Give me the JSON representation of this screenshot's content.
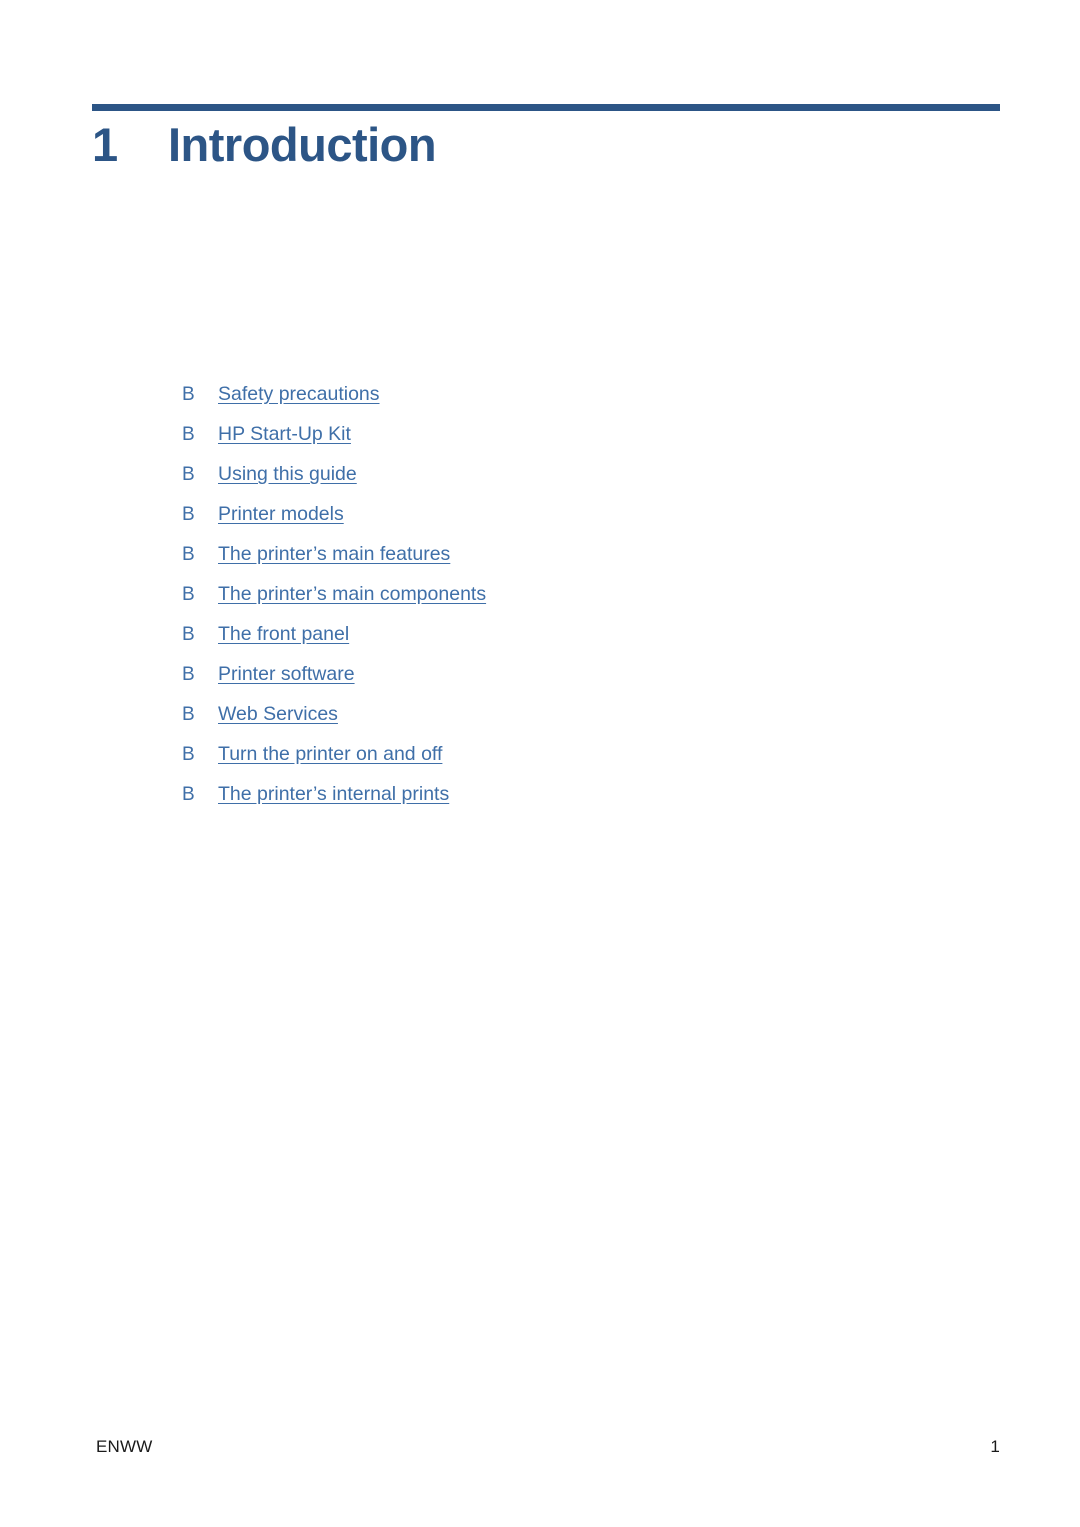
{
  "document": {
    "page_background": "#ffffff",
    "accent_color": "#2c5586",
    "link_color": "#3f6fa8"
  },
  "heading": {
    "rule_color": "#2c5586",
    "number": "1",
    "title": "Introduction"
  },
  "contents": {
    "bullet_glyph": "B",
    "items": [
      {
        "bullet": "B",
        "label": "Safety precautions"
      },
      {
        "bullet": "B",
        "label": "HP Start-Up Kit"
      },
      {
        "bullet": "B",
        "label": "Using this guide"
      },
      {
        "bullet": "B",
        "label": "Printer models"
      },
      {
        "bullet": "B",
        "label": "The printer’s main features"
      },
      {
        "bullet": "B",
        "label": "The printer’s main components"
      },
      {
        "bullet": "B",
        "label": "The front panel"
      },
      {
        "bullet": "B",
        "label": "Printer software"
      },
      {
        "bullet": "B",
        "label": "Web Services"
      },
      {
        "bullet": "B",
        "label": "Turn the printer on and off"
      },
      {
        "bullet": "B",
        "label": "The printer’s internal prints"
      }
    ]
  },
  "footer": {
    "left": "ENWW",
    "page_number": "1"
  }
}
